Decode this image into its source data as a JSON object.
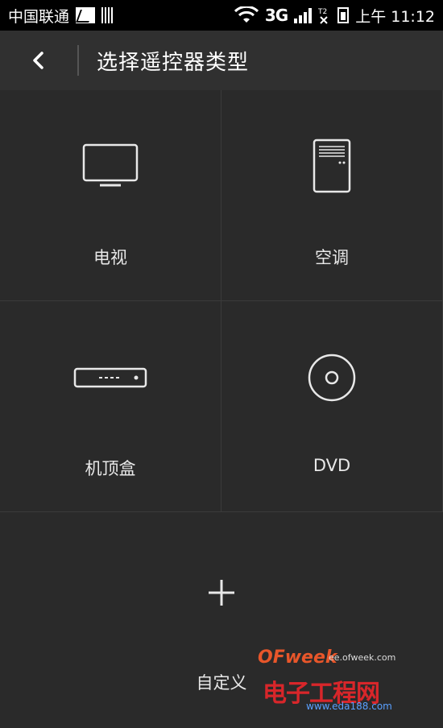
{
  "status_bar": {
    "carrier": "中国联通",
    "network": "3G",
    "time": "上午 11:12"
  },
  "header": {
    "title": "选择遥控器类型"
  },
  "device_types": [
    {
      "label": "电视",
      "icon": "tv-icon"
    },
    {
      "label": "空调",
      "icon": "air-conditioner-icon"
    },
    {
      "label": "机顶盒",
      "icon": "set-top-box-icon"
    },
    {
      "label": "DVD",
      "icon": "dvd-disc-icon"
    }
  ],
  "custom": {
    "label": "自定义",
    "icon": "plus-icon"
  },
  "watermark": {
    "brand": "OFweek",
    "site": "ee.ofweek.com",
    "chinese": "电子工程网",
    "url": "www.eda188.com"
  }
}
